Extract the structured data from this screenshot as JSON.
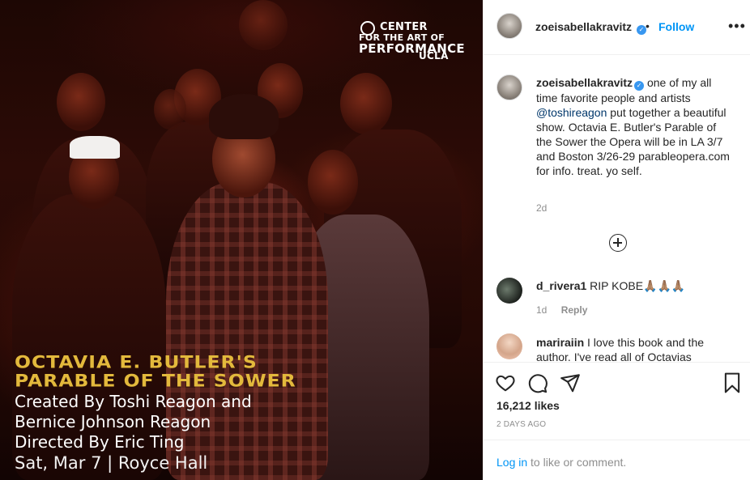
{
  "poster": {
    "org_line1": "CENTER",
    "org_line2": "FOR THE ART OF",
    "org_line3": "PERFORMANCE",
    "org_line4": "UCLA",
    "title_line1": "OCTAVIA E. BUTLER'S",
    "title_line2": "PARABLE OF THE SOWER",
    "credit_line1": "Created By Toshi Reagon and",
    "credit_line2": "Bernice Johnson Reagon",
    "credit_line3": "Directed By Eric Ting",
    "date_line": "Sat, Mar 7 | Royce Hall",
    "title_color": "#e3b93c"
  },
  "header": {
    "username": "zoeisabellakravitz",
    "separator": "•",
    "follow_label": "Follow",
    "more_icon": "more-horizontal-icon"
  },
  "caption": {
    "username": "zoeisabellakravitz",
    "text_before": " one of my all time favorite people and artists ",
    "mention": "@toshireagon",
    "text_after": " put together a beautiful show. Octavia E. Butler's Parable of the Sower the Opera will be in LA 3/7 and Boston 3/26-29 parableopera.com for info. treat. yo self.",
    "time": "2d"
  },
  "comments": [
    {
      "username": "d_rivera1",
      "text": " RIP KOBE🙏🏽🙏🏽🙏🏽",
      "time": "1d",
      "reply_label": "Reply"
    },
    {
      "username": "mariraiin",
      "text": " I love this book and the author. I've read all of Octavias"
    }
  ],
  "actions": {
    "likes": "16,212 likes",
    "date": "2 DAYS AGO"
  },
  "login": {
    "link": "Log in",
    "text": " to like or comment."
  },
  "colors": {
    "accent": "#0095f6",
    "verified": "#3897f0",
    "muted": "#8e8e8e"
  }
}
